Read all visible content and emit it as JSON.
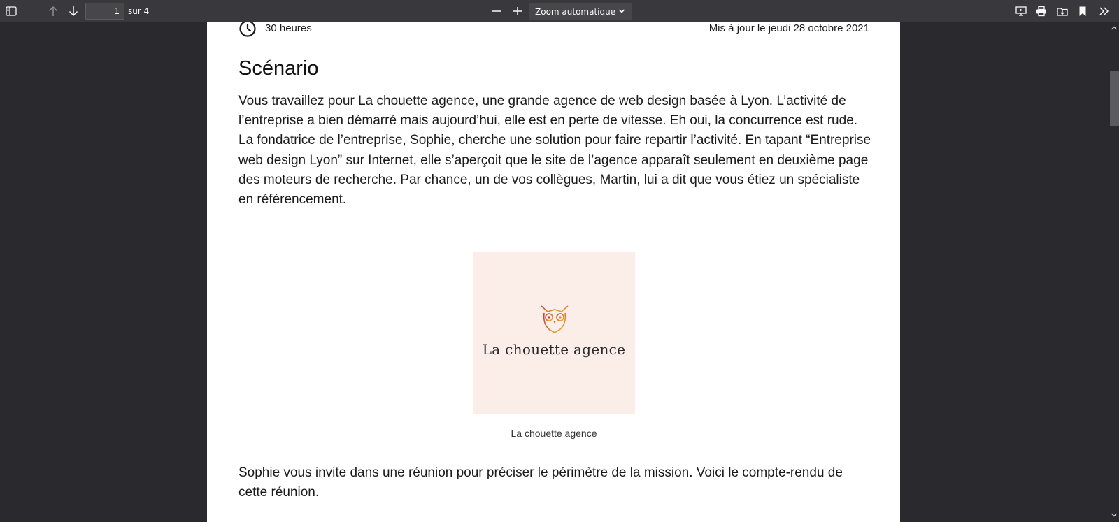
{
  "toolbar": {
    "sidebar_toggle_icon": "sidebar-toggle-icon",
    "page_number": "1",
    "page_count": "sur 4",
    "zoom_value": "Zoom automatique",
    "icons": [
      "sidebar-toggle-icon",
      "arrow-up-icon",
      "arrow-down-icon",
      "zoom-out-icon",
      "zoom-in-icon",
      "presentation-icon",
      "print-icon",
      "download-icon",
      "bookmark-icon",
      "more-tools-icon"
    ]
  },
  "document": {
    "duration": "30 heures",
    "updated": "Mis à jour le jeudi 28 octobre 2021",
    "title": "Scénario",
    "paragraph1": "Vous travaillez pour La chouette agence, une grande agence de web design basée à Lyon. L’activité de l’entreprise a bien démarré mais aujourd’hui, elle est en perte de vitesse. Eh oui, la concurrence est rude. La fondatrice de l’entreprise, Sophie, cherche une solution pour faire repartir l’activité. En tapant “Entreprise web design Lyon” sur Internet, elle s’aperçoit que le site de l’agence apparaît seulement en deuxième page des moteurs de recherche. Par chance, un de vos collègues, Martin, lui a dit que vous étiez un spécialiste en référencement.",
    "logo_text": "La chouette agence",
    "caption": "La chouette agence",
    "paragraph2": "Sophie vous invite dans une réunion pour préciser le périmètre de la mission. Voici le compte-rendu de cette réunion."
  },
  "colors": {
    "toolbar_bg": "#38383d",
    "viewer_bg": "#2a2a2e",
    "page_bg": "#ffffff",
    "logo_bg": "#fbeee9"
  }
}
